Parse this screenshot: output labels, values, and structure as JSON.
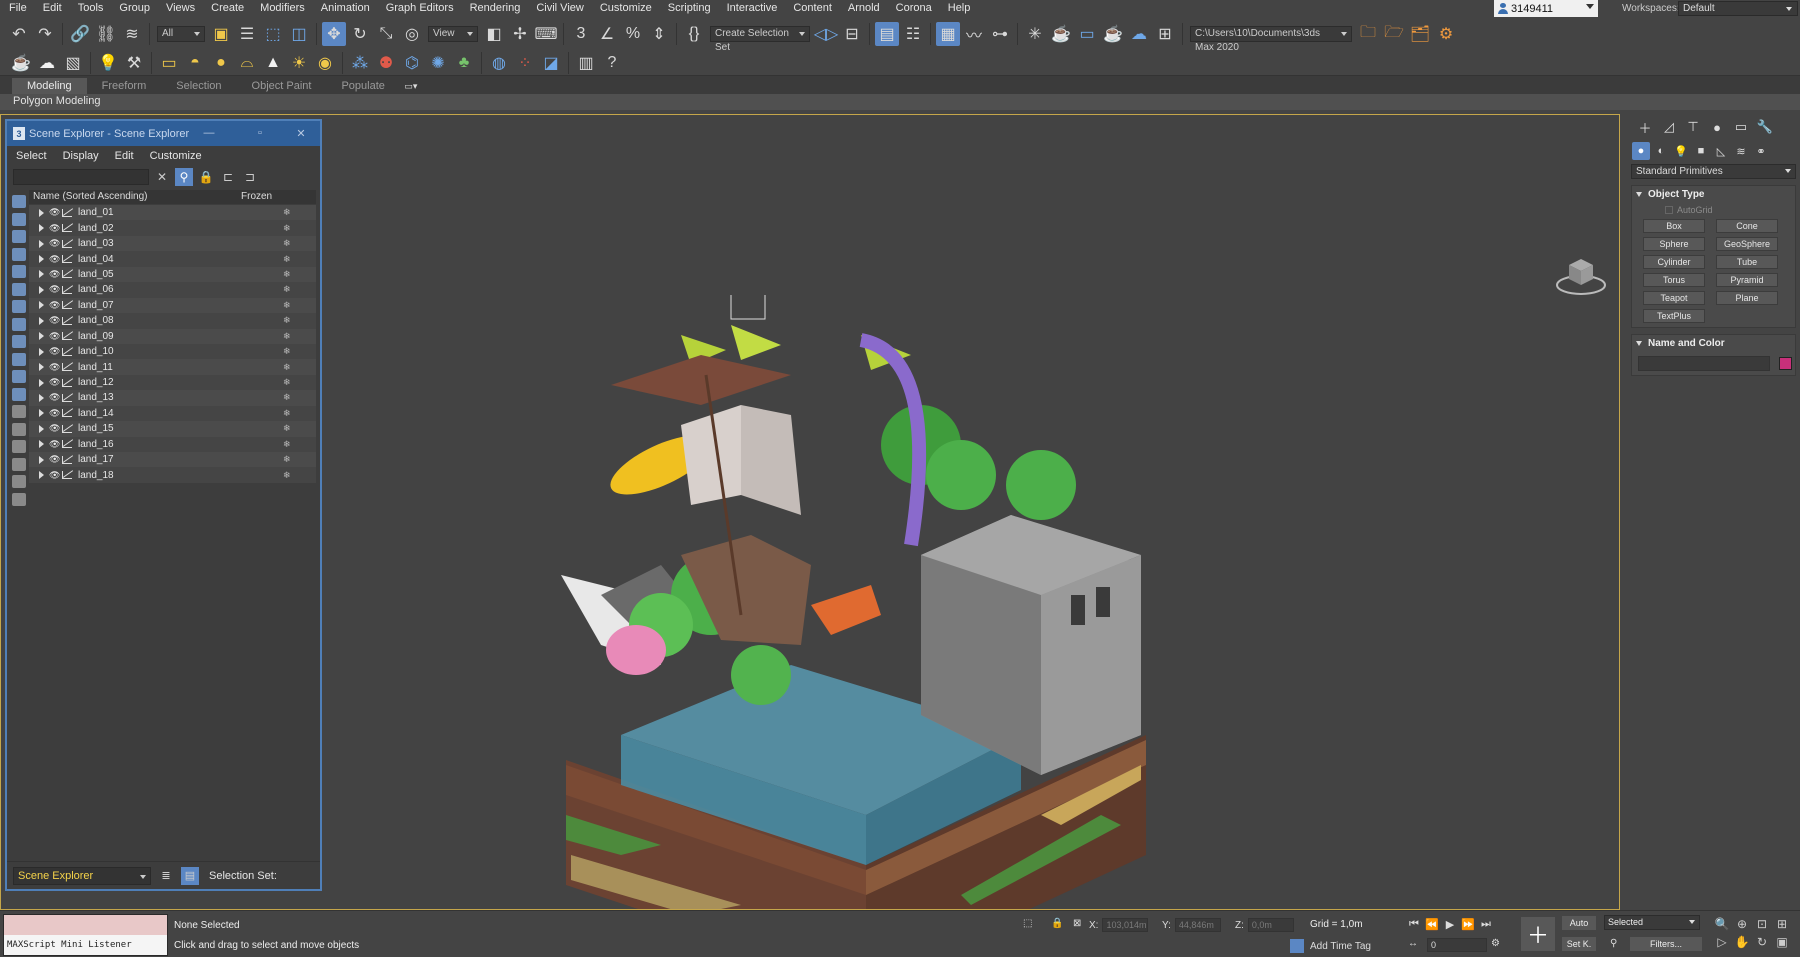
{
  "menu": {
    "items": [
      "File",
      "Edit",
      "Tools",
      "Group",
      "Views",
      "Create",
      "Modifiers",
      "Animation",
      "Graph Editors",
      "Rendering",
      "Civil View",
      "Customize",
      "Scripting",
      "Interactive",
      "Content",
      "Arnold",
      "Corona",
      "Help"
    ]
  },
  "account": {
    "user": "3149411",
    "workspaces_label": "Workspaces:",
    "workspace": "Default"
  },
  "toolbar": {
    "filter_value": "All",
    "view_value": "View",
    "selection_set_placeholder": "Create Selection Set",
    "project_path": "C:\\Users\\10\\Documents\\3ds Max 2020"
  },
  "ribbon": {
    "tabs": [
      "Modeling",
      "Freeform",
      "Selection",
      "Object Paint",
      "Populate"
    ],
    "active_tab": "Modeling",
    "sub_label": "Polygon Modeling"
  },
  "scene_explorer": {
    "title": "Scene Explorer - Scene Explorer",
    "menu": [
      "Select",
      "Display",
      "Edit",
      "Customize"
    ],
    "column_name": "Name (Sorted Ascending)",
    "column_frozen": "Frozen",
    "rows": [
      "land_01",
      "land_02",
      "land_03",
      "land_04",
      "land_05",
      "land_06",
      "land_07",
      "land_08",
      "land_09",
      "land_10",
      "land_11",
      "land_12",
      "land_13",
      "land_14",
      "land_15",
      "land_16",
      "land_17",
      "land_18"
    ],
    "bottom_dropdown": "Scene Explorer",
    "selection_set_label": "Selection Set:"
  },
  "command_panel": {
    "category": "Standard Primitives",
    "object_type_title": "Object Type",
    "autogrid": "AutoGrid",
    "object_buttons": [
      "Box",
      "Cone",
      "Sphere",
      "GeoSphere",
      "Cylinder",
      "Tube",
      "Torus",
      "Pyramid",
      "Teapot",
      "Plane",
      "TextPlus"
    ],
    "name_color_title": "Name and Color",
    "object_color": "#c8307a"
  },
  "status": {
    "maxscript": "MAXScript Mini Listener",
    "selection": "None Selected",
    "prompt": "Click and drag to select and move objects",
    "x_label": "X:",
    "x_value": "103,014m",
    "y_label": "Y:",
    "y_value": "44,846m",
    "z_label": "Z:",
    "z_value": "0,0m",
    "grid": "Grid = 1,0m",
    "add_time_tag": "Add Time Tag",
    "frame": "0",
    "auto": "Auto",
    "set_key": "Set K.",
    "key_filter": "Selected",
    "filters": "Filters..."
  },
  "colors": {
    "accent": "#5b87c4",
    "viewport_border": "#c5a64a",
    "scene_explorer_title": "#2f5f99"
  }
}
